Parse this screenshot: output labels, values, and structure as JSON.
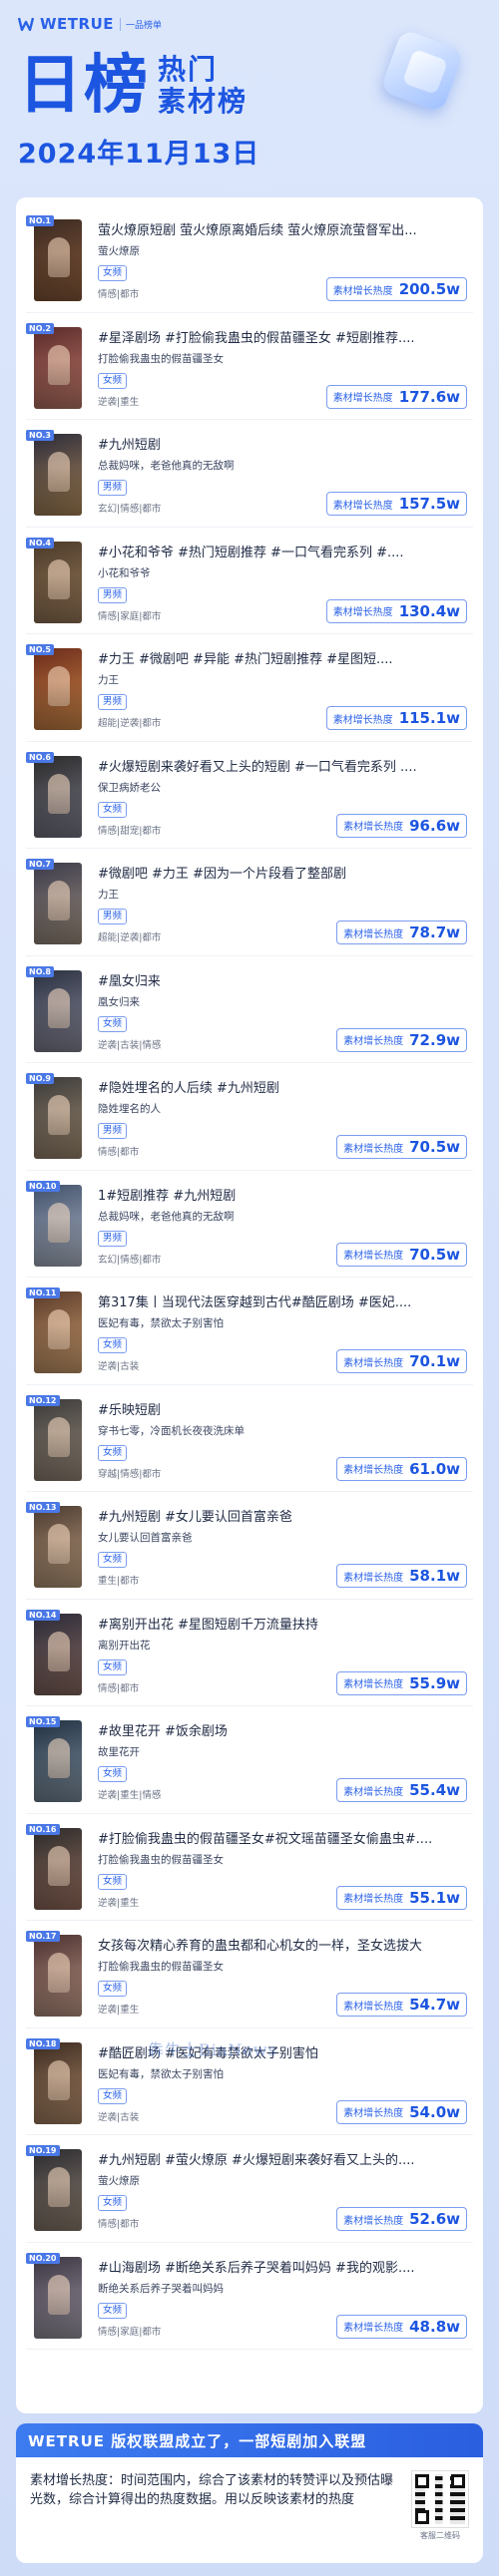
{
  "brand": {
    "name": "WETRUE",
    "sub": "一品榜单"
  },
  "header": {
    "title_big": "日榜",
    "title_line1": "热门",
    "title_line2": "素材榜",
    "date": "2024年11月13日"
  },
  "labels": {
    "heat_label": "素材增长热度"
  },
  "colors": {
    "accent": "#1c55e0",
    "badge_border": "#7a9df0",
    "background": "#dbe6fb"
  },
  "items": [
    {
      "rank": "NO.1",
      "title": "萤火燎原短剧 萤火燎原离婚后续 萤火燎原流萤督军出...",
      "sub": "萤火燎原",
      "badge": "女频",
      "genre": "情感|都市",
      "heat": "200.5w",
      "thumb": [
        "#3a2a22",
        "#8a5a3a"
      ]
    },
    {
      "rank": "NO.2",
      "title": "#星泽剧场 #打脸偷我蛊虫的假苗疆圣女 #短剧推荐....",
      "sub": "打脸偷我蛊虫的假苗疆圣女",
      "badge": "女频",
      "genre": "逆袭|重生",
      "heat": "177.6w",
      "thumb": [
        "#5a2a2a",
        "#c07a6a"
      ]
    },
    {
      "rank": "NO.3",
      "title": "#九州短剧",
      "sub": "总裁妈咪，老爸他真的无敌啊",
      "badge": "男频",
      "genre": "玄幻|情感|都市",
      "heat": "157.5w",
      "thumb": [
        "#2a2a3a",
        "#b08a5a"
      ]
    },
    {
      "rank": "NO.4",
      "title": "#小花和爷爷 #热门短剧推荐 #一口气看完系列 #....",
      "sub": "小花和爷爷",
      "badge": "男频",
      "genre": "情感|家庭|都市",
      "heat": "130.4w",
      "thumb": [
        "#4a3a2a",
        "#9a7a5a"
      ]
    },
    {
      "rank": "NO.5",
      "title": "#力王 #微剧吧 #异能 #热门短剧推荐 #星图短....",
      "sub": "力王",
      "badge": "男频",
      "genre": "超能|逆袭|都市",
      "heat": "115.1w",
      "thumb": [
        "#6a2a1a",
        "#d08a4a"
      ]
    },
    {
      "rank": "NO.6",
      "title": "#火爆短剧来袭好看又上头的短剧 #一口气看完系列 ....",
      "sub": "保卫病娇老公",
      "badge": "女频",
      "genre": "情感|甜宠|都市",
      "heat": "96.6w",
      "thumb": [
        "#2a2a2a",
        "#7a7a8a"
      ]
    },
    {
      "rank": "NO.7",
      "title": "#微剧吧 #力王 #因为一个片段看了整部剧",
      "sub": "力王",
      "badge": "男频",
      "genre": "超能|逆袭|都市",
      "heat": "78.7w",
      "thumb": [
        "#3a3a4a",
        "#a09080"
      ]
    },
    {
      "rank": "NO.8",
      "title": "#凰女归来",
      "sub": "凰女归来",
      "badge": "女频",
      "genre": "逆袭|古装|情感",
      "heat": "72.9w",
      "thumb": [
        "#2a3040",
        "#8a8a9a"
      ]
    },
    {
      "rank": "NO.9",
      "title": "#隐姓埋名的人后续 #九州短剧",
      "sub": "隐姓埋名的人",
      "badge": "男频",
      "genre": "情感|都市",
      "heat": "70.5w",
      "thumb": [
        "#3a3a3a",
        "#a08a70"
      ]
    },
    {
      "rank": "NO.10",
      "title": "1#短剧推荐 #九州短剧",
      "sub": "总裁妈咪，老爸他真的无敌啊",
      "badge": "男频",
      "genre": "玄幻|情感|都市",
      "heat": "70.5w",
      "thumb": [
        "#40506a",
        "#b0b8c8"
      ]
    },
    {
      "rank": "NO.11",
      "title": "第317集丨当现代法医穿越到古代#酷匠剧场 #医妃....",
      "sub": "医妃有毒，禁欲太子别害怕",
      "badge": "女频",
      "genre": "逆袭|古装",
      "heat": "70.1w",
      "thumb": [
        "#5a3a2a",
        "#d0a070"
      ]
    },
    {
      "rank": "NO.12",
      "title": "#乐映短剧",
      "sub": "穿书七零，冷面机长夜夜洗床单",
      "badge": "女频",
      "genre": "穿越|情感|都市",
      "heat": "61.0w",
      "thumb": [
        "#3a3a3a",
        "#9a8a7a"
      ]
    },
    {
      "rank": "NO.13",
      "title": "#九州短剧 #女儿要认回首富亲爸",
      "sub": "女儿要认回首富亲爸",
      "badge": "女频",
      "genre": "重生|都市",
      "heat": "58.1w",
      "thumb": [
        "#4a3a30",
        "#c0a080"
      ]
    },
    {
      "rank": "NO.14",
      "title": "#离别开出花 #星图短剧千万流量扶持",
      "sub": "离别开出花",
      "badge": "女频",
      "genre": "情感|都市",
      "heat": "55.9w",
      "thumb": [
        "#2a2a38",
        "#8a6a60"
      ]
    },
    {
      "rank": "NO.15",
      "title": "#故里花开 #饭余剧场",
      "sub": "故里花开",
      "badge": "女频",
      "genre": "逆袭|重生|情感",
      "heat": "55.4w",
      "thumb": [
        "#203040",
        "#8090a0"
      ]
    },
    {
      "rank": "NO.16",
      "title": "#打脸偷我蛊虫的假苗疆圣女#祝文瑶苗疆圣女偷蛊虫#....",
      "sub": "打脸偷我蛊虫的假苗疆圣女",
      "badge": "女频",
      "genre": "逆袭|重生",
      "heat": "55.1w",
      "thumb": [
        "#2a2a2a",
        "#9a7060"
      ]
    },
    {
      "rank": "NO.17",
      "title": "女孩每次精心养育的蛊虫都和心机女的一样，圣女选拔大",
      "sub": "打脸偷我蛊虫的假苗疆圣女",
      "badge": "女频",
      "genre": "逆袭|重生",
      "heat": "54.7w",
      "thumb": [
        "#4a3030",
        "#c09a88"
      ]
    },
    {
      "rank": "NO.18",
      "title": "#酷匠剧场 #医妃有毒禁欲太子别害怕",
      "sub": "医妃有毒，禁欲太子别害怕",
      "badge": "女频",
      "genre": "逆袭|古装",
      "heat": "54.0w",
      "thumb": [
        "#3a2a20",
        "#b08a6a"
      ]
    },
    {
      "rank": "NO.19",
      "title": "#九州短剧 #萤火燎原 #火爆短剧来袭好看又上头的....",
      "sub": "萤火燎原",
      "badge": "女频",
      "genre": "情感|都市",
      "heat": "52.6w",
      "thumb": [
        "#2a2a30",
        "#908070"
      ]
    },
    {
      "rank": "NO.20",
      "title": "#山海剧场 #断绝关系后养子哭着叫妈妈 #我的观影....",
      "sub": "断绝关系后养子哭着叫妈妈",
      "badge": "女频",
      "genre": "情感|家庭|都市",
      "heat": "48.8w",
      "thumb": [
        "#3a3440",
        "#a09aa8"
      ]
    }
  ],
  "watermark": "犇牛士BiaNews",
  "banner": {
    "title": "WETRUE 版权联盟成立了，一部短剧加入联盟",
    "note": "素材增长热度：时间范围内，综合了该素材的转赞评以及预估曝光数，综合计算得出的热度数据。用以反映该素材的热度",
    "qr_caption": "客服二维码"
  }
}
